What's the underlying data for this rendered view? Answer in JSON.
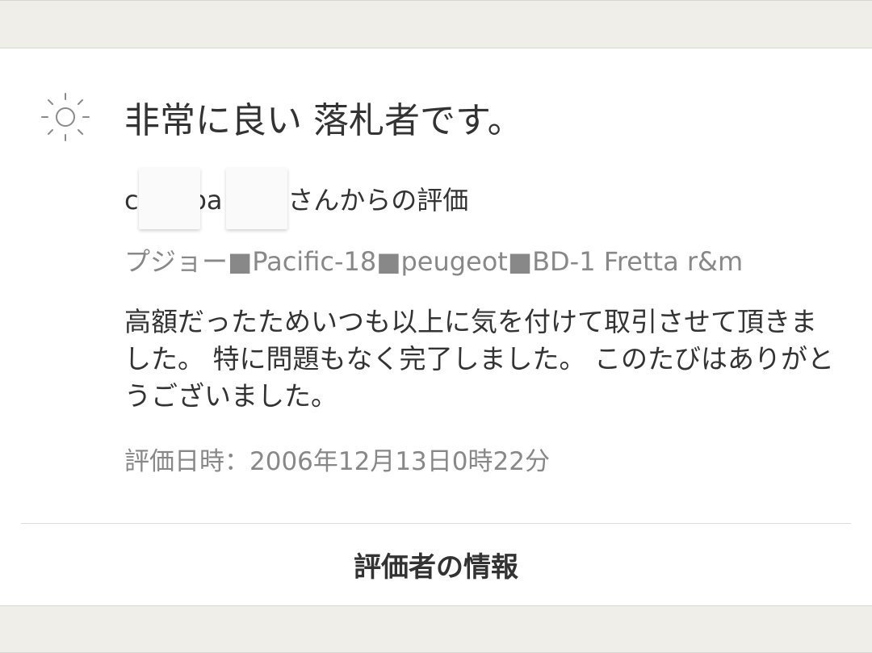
{
  "rating": {
    "icon": "sun-icon",
    "title": "非常に良い 落札者です。"
  },
  "reviewer": {
    "from_text": "c　　pa　　sさんからの評価"
  },
  "item": {
    "name": "プジョー■Pacific-18■peugeot■BD-1 Fretta r&m"
  },
  "comment": {
    "text": "高額だったためいつも以上に気を付けて取引させて頂きました。 特に問題もなく完了しました。 このたびはありがとうございました。"
  },
  "date": {
    "text": "評価日時：2006年12月13日0時22分"
  },
  "actions": {
    "reviewer_info_label": "評価者の情報"
  },
  "colors": {
    "background": "#efeee9",
    "card": "#ffffff",
    "primary_text": "#333333",
    "secondary_text": "#888888"
  }
}
